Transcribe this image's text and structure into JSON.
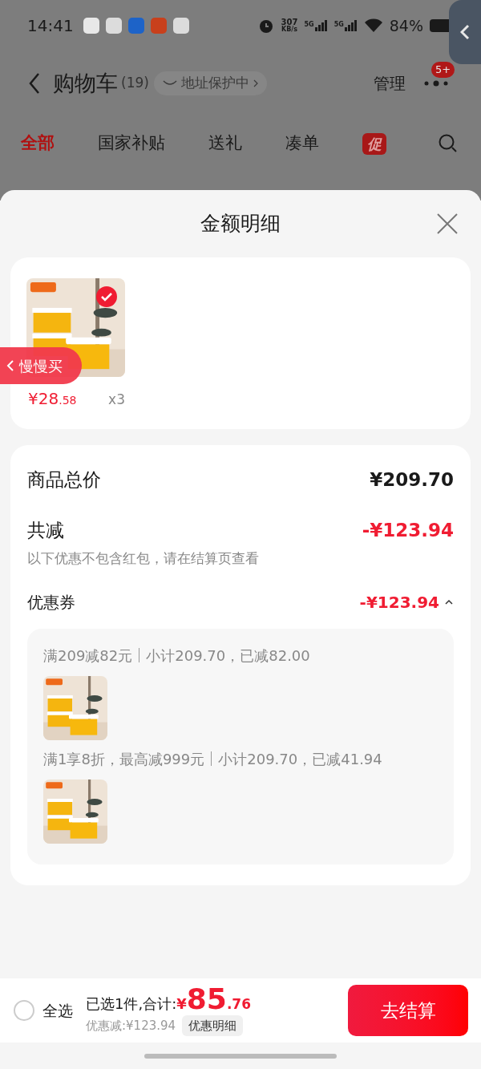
{
  "status_bar": {
    "time": "14:41",
    "speed_value": "307",
    "speed_unit": "KB/s",
    "signals": [
      "5G",
      "5G"
    ],
    "battery": "84%"
  },
  "header": {
    "title": "购物车",
    "count": "(19)",
    "address_badge": "地址保护中",
    "manage": "管理",
    "more_badge": "5+"
  },
  "tabs": [
    {
      "label": "全部",
      "selected": true,
      "kind": "text"
    },
    {
      "label": "国家补贴",
      "selected": false,
      "kind": "text"
    },
    {
      "label": "送礼",
      "selected": false,
      "kind": "text"
    },
    {
      "label": "凑单",
      "selected": false,
      "kind": "text"
    },
    {
      "label": "促",
      "selected": false,
      "kind": "promo"
    }
  ],
  "sheet": {
    "title": "金额明细",
    "items": [
      {
        "price": "¥28",
        "price_decimal": ".58",
        "quantity": "x3",
        "checked": true
      }
    ],
    "float_tab": "慢慢买",
    "summary": {
      "total_label": "商品总价",
      "total_value": "¥209.70",
      "reduction_label": "共减",
      "reduction_value": "-¥123.94",
      "note": "以下优惠不包含红包，请在结算页查看",
      "coupon_label": "优惠券",
      "coupon_value": "-¥123.94",
      "expanded": true,
      "coupon_groups": [
        {
          "rule": "满209减82元",
          "detail": "小计209.70，已减82.00"
        },
        {
          "rule": "满1享8折，最高减999元",
          "detail": "小计209.70，已减41.94"
        }
      ]
    }
  },
  "footer": {
    "select_all": {
      "label": "全选",
      "checked": false
    },
    "selected_text": "已选1件,合计:",
    "currency": "¥",
    "total_integer": "85",
    "total_decimal": ".76",
    "discount": "优惠减:¥123.94",
    "details_button": "优惠明细",
    "checkout": "去结算"
  }
}
